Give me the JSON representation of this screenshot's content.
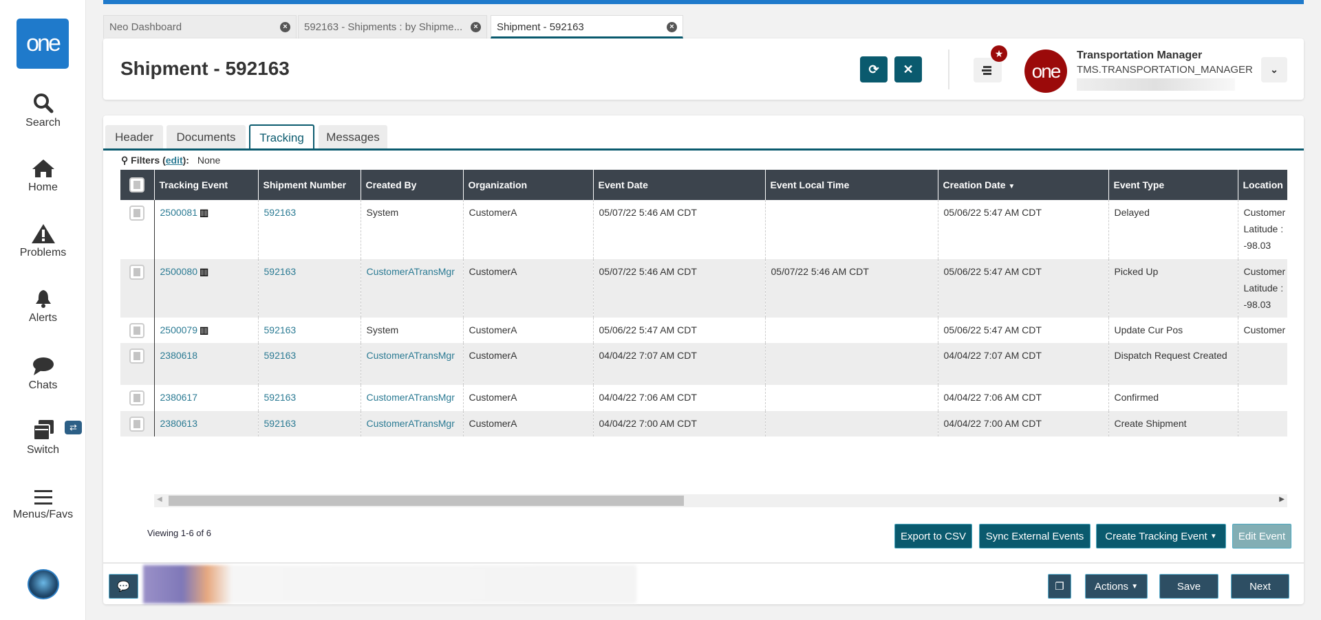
{
  "sidebar": {
    "logo": "one",
    "items": [
      {
        "label": "Search"
      },
      {
        "label": "Home"
      },
      {
        "label": "Problems"
      },
      {
        "label": "Alerts"
      },
      {
        "label": "Chats"
      },
      {
        "label": "Switch"
      },
      {
        "label": "Menus/Favs"
      }
    ]
  },
  "window_tabs": [
    {
      "label": "Neo Dashboard"
    },
    {
      "label": "592163 - Shipments : by Shipme..."
    },
    {
      "label": "Shipment - 592163"
    }
  ],
  "header": {
    "title": "Shipment - 592163",
    "user_name": "Transportation Manager",
    "user_role": "TMS.TRANSPORTATION_MANAGER",
    "avatar_text": "one"
  },
  "subtabs": [
    {
      "label": "Header"
    },
    {
      "label": "Documents"
    },
    {
      "label": "Tracking"
    },
    {
      "label": "Messages"
    }
  ],
  "filters": {
    "label": "Filters",
    "edit": "edit",
    "value": "None"
  },
  "table": {
    "columns": [
      "Tracking Event",
      "Shipment Number",
      "Created By",
      "Organization",
      "Event Date",
      "Event Local Time",
      "Creation Date",
      "Event Type",
      "Location"
    ],
    "rows": [
      {
        "tracking_event": "2500081",
        "shipment": "592163",
        "created_by": "System",
        "org": "CustomerA",
        "event_date": "05/07/22 5:46 AM CDT",
        "local_time": "",
        "creation_date": "05/06/22 5:47 AM CDT",
        "event_type": "Delayed",
        "loc1": "Customer",
        "loc2": "Latitude :",
        "loc3": "-98.03"
      },
      {
        "tracking_event": "2500080",
        "shipment": "592163",
        "created_by": "CustomerATransMgr",
        "org": "CustomerA",
        "event_date": "05/07/22 5:46 AM CDT",
        "local_time": "05/07/22 5:46 AM CDT",
        "creation_date": "05/06/22 5:47 AM CDT",
        "event_type": "Picked Up",
        "loc1": "Customer",
        "loc2": "Latitude :",
        "loc3": "-98.03"
      },
      {
        "tracking_event": "2500079",
        "shipment": "592163",
        "created_by": "System",
        "org": "CustomerA",
        "event_date": "05/06/22 5:47 AM CDT",
        "local_time": "",
        "creation_date": "05/06/22 5:47 AM CDT",
        "event_type": "Update Cur Pos",
        "loc1": "Customer",
        "loc2": "",
        "loc3": ""
      },
      {
        "tracking_event": "2380618",
        "shipment": "592163",
        "created_by": "CustomerATransMgr",
        "org": "CustomerA",
        "event_date": "04/04/22 7:07 AM CDT",
        "local_time": "",
        "creation_date": "04/04/22 7:07 AM CDT",
        "event_type": "Dispatch Request Created",
        "loc1": "",
        "loc2": "",
        "loc3": ""
      },
      {
        "tracking_event": "2380617",
        "shipment": "592163",
        "created_by": "CustomerATransMgr",
        "org": "CustomerA",
        "event_date": "04/04/22 7:06 AM CDT",
        "local_time": "",
        "creation_date": "04/04/22 7:06 AM CDT",
        "event_type": "Confirmed",
        "loc1": "",
        "loc2": "",
        "loc3": ""
      },
      {
        "tracking_event": "2380613",
        "shipment": "592163",
        "created_by": "CustomerATransMgr",
        "org": "CustomerA",
        "event_date": "04/04/22 7:00 AM CDT",
        "local_time": "",
        "creation_date": "04/04/22 7:00 AM CDT",
        "event_type": "Create Shipment",
        "loc1": "",
        "loc2": "",
        "loc3": ""
      }
    ]
  },
  "pager": {
    "text": "Viewing 1-6 of 6"
  },
  "actions": {
    "export": "Export to CSV",
    "sync": "Sync External Events",
    "create": "Create Tracking Event",
    "edit": "Edit Event"
  },
  "footer": {
    "actions": "Actions",
    "save": "Save",
    "next": "Next"
  }
}
